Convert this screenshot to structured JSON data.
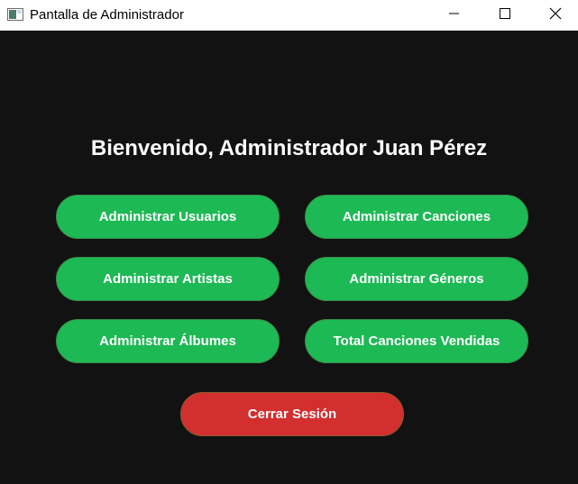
{
  "window": {
    "title": "Pantalla de Administrador",
    "icon": "app-window-icon",
    "controls": {
      "minimize_icon": "minimize-icon",
      "maximize_icon": "maximize-icon",
      "close_icon": "close-icon"
    }
  },
  "main": {
    "welcome": "Bienvenido, Administrador Juan Pérez",
    "buttons": [
      {
        "label": "Administrar Usuarios"
      },
      {
        "label": "Administrar Canciones"
      },
      {
        "label": "Administrar Artistas"
      },
      {
        "label": "Administrar Géneros"
      },
      {
        "label": "Administrar Álbumes"
      },
      {
        "label": "Total Canciones Vendidas"
      }
    ],
    "logout": {
      "label": "Cerrar Sesión"
    }
  },
  "colors": {
    "background": "#121212",
    "primary_button": "#1db954",
    "logout_button": "#d32f2f",
    "text": "#ffffff"
  }
}
